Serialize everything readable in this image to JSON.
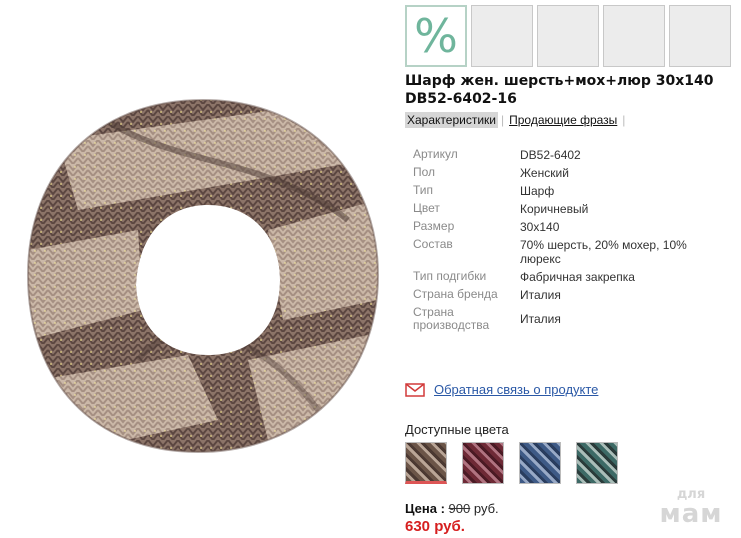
{
  "thumbnails": {
    "discount_glyph": "%"
  },
  "product": {
    "title": "Шарф жен. шерсть+мох+люр 30х140 DB52-6402-16"
  },
  "tabs": [
    {
      "label": "Характеристики"
    },
    {
      "label": "Продающие фразы"
    }
  ],
  "specs": [
    {
      "label": "Артикул",
      "value": "DB52-6402"
    },
    {
      "label": "Пол",
      "value": "Женский"
    },
    {
      "label": "Тип",
      "value": "Шарф"
    },
    {
      "label": "Цвет",
      "value": "Коричневый"
    },
    {
      "label": "Размер",
      "value": "30х140"
    },
    {
      "label": "Состав",
      "value": "70% шерсть, 20% мохер, 10% люрекс"
    },
    {
      "label": "Тип подгибки",
      "value": "Фабричная закрепка"
    },
    {
      "label": "Страна бренда",
      "value": "Италия"
    },
    {
      "label": "Страна производства",
      "value": "Италия"
    }
  ],
  "feedback": {
    "label": "Обратная связь о продукте",
    "icon": "envelope-icon"
  },
  "colors": {
    "label": "Доступные цвета",
    "swatches": [
      {
        "name": "brown",
        "color": "#6b5548"
      },
      {
        "name": "burgundy",
        "color": "#6e2a36"
      },
      {
        "name": "blue",
        "color": "#3e5a86"
      },
      {
        "name": "teal",
        "color": "#3d6a66"
      }
    ]
  },
  "price": {
    "label": "Цена :",
    "old": "900",
    "currency": "руб.",
    "new": "630 руб."
  },
  "watermark": {
    "line1": "для",
    "line2": "мам"
  }
}
